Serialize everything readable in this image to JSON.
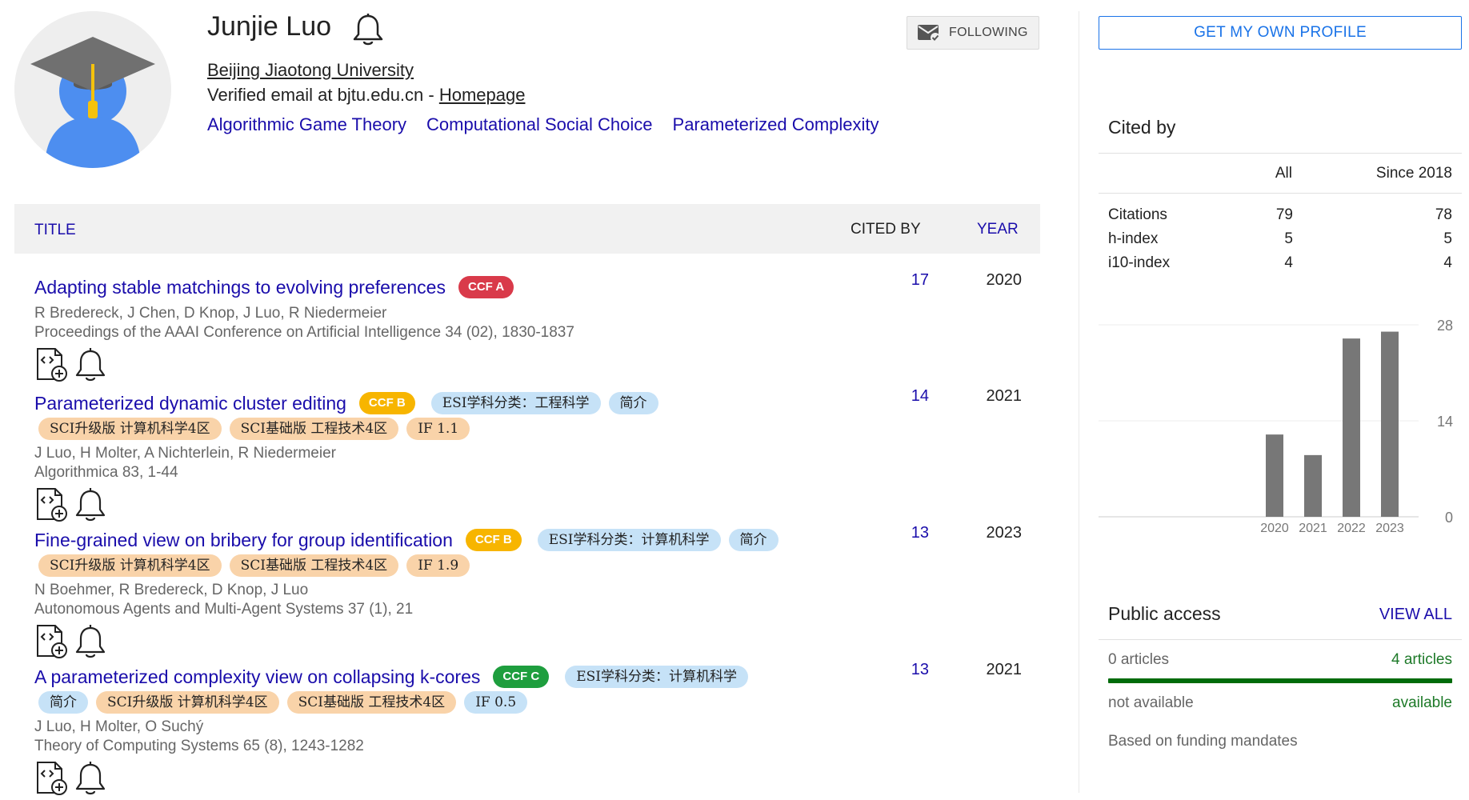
{
  "profile": {
    "name": "Junjie Luo",
    "affiliation": "Beijing Jiaotong University",
    "email_text": "Verified email at bjtu.edu.cn - ",
    "homepage_label": "Homepage",
    "interests": [
      "Algorithmic Game Theory",
      "Computational Social Choice",
      "Parameterized Complexity"
    ],
    "follow_label": "FOLLOWING"
  },
  "table": {
    "headers": {
      "title": "TITLE",
      "cited_by": "CITED BY",
      "year": "YEAR"
    },
    "articles": [
      {
        "title": "Adapting stable matchings to evolving preferences",
        "ccf": "CCF A",
        "tags_row1": [],
        "tags_row2": [],
        "authors": "R Bredereck, J Chen, D Knop, J Luo, R Niedermeier",
        "venue": "Proceedings of the AAAI Conference on Artificial Intelligence 34 (02), 1830-1837",
        "cited_by": "17",
        "year": "2020"
      },
      {
        "title": "Parameterized dynamic cluster editing",
        "ccf": "CCF B",
        "tags_row1": [
          "ESI学科分类：工程科学",
          "简介"
        ],
        "tags_row2": [
          "SCI升级版 计算机科学4区",
          "SCI基础版 工程技术4区",
          "IF 1.1"
        ],
        "authors": "J Luo, H Molter, A Nichterlein, R Niedermeier",
        "venue": "Algorithmica 83, 1-44",
        "cited_by": "14",
        "year": "2021"
      },
      {
        "title": "Fine-grained view on bribery for group identification",
        "ccf": "CCF B",
        "tags_row1": [
          "ESI学科分类：计算机科学",
          "简介"
        ],
        "tags_row2": [
          "SCI升级版 计算机科学4区",
          "SCI基础版 工程技术4区",
          "IF 1.9"
        ],
        "authors": "N Boehmer, R Bredereck, D Knop, J Luo",
        "venue": "Autonomous Agents and Multi-Agent Systems 37 (1), 21",
        "cited_by": "13",
        "year": "2023"
      },
      {
        "title": "A parameterized complexity view on collapsing k-cores",
        "ccf": "CCF C",
        "tags_row1": [
          "ESI学科分类：计算机科学"
        ],
        "tags_row2": [
          "简介",
          "SCI升级版 计算机科学4区",
          "SCI基础版 工程技术4区",
          "IF 0.5"
        ],
        "authors": "J Luo, H Molter, O Suchý",
        "venue": "Theory of Computing Systems 65 (8), 1243-1282",
        "cited_by": "13",
        "year": "2021"
      }
    ]
  },
  "sidebar": {
    "get_profile_label": "GET MY OWN PROFILE",
    "cited_by": {
      "title": "Cited by",
      "col_all": "All",
      "col_since": "Since 2018",
      "rows": [
        {
          "label": "Citations",
          "all": "79",
          "since": "78"
        },
        {
          "label": "h-index",
          "all": "5",
          "since": "5"
        },
        {
          "label": "i10-index",
          "all": "4",
          "since": "4"
        }
      ]
    },
    "public_access": {
      "title": "Public access",
      "view_all": "VIEW ALL",
      "unavailable_count": "0 articles",
      "available_count": "4 articles",
      "unavailable_label": "not available",
      "available_label": "available",
      "note": "Based on funding mandates",
      "available_fraction": 1.0
    }
  },
  "colors": {
    "link": "#1a0dab",
    "ccf_a": "#d93a4a",
    "ccf_b": "#f7b500",
    "ccf_c": "#1e9e3e",
    "tag_blue": "#c6e2f7",
    "tag_orange": "#f9d3a9",
    "bar": "#777777",
    "access_green": "#006b0b"
  },
  "chart_data": {
    "type": "bar",
    "categories": [
      "2020",
      "2021",
      "2022",
      "2023"
    ],
    "values": [
      12,
      9,
      26,
      27
    ],
    "yticks": [
      0,
      14,
      28
    ],
    "ylim": [
      0,
      28
    ]
  }
}
